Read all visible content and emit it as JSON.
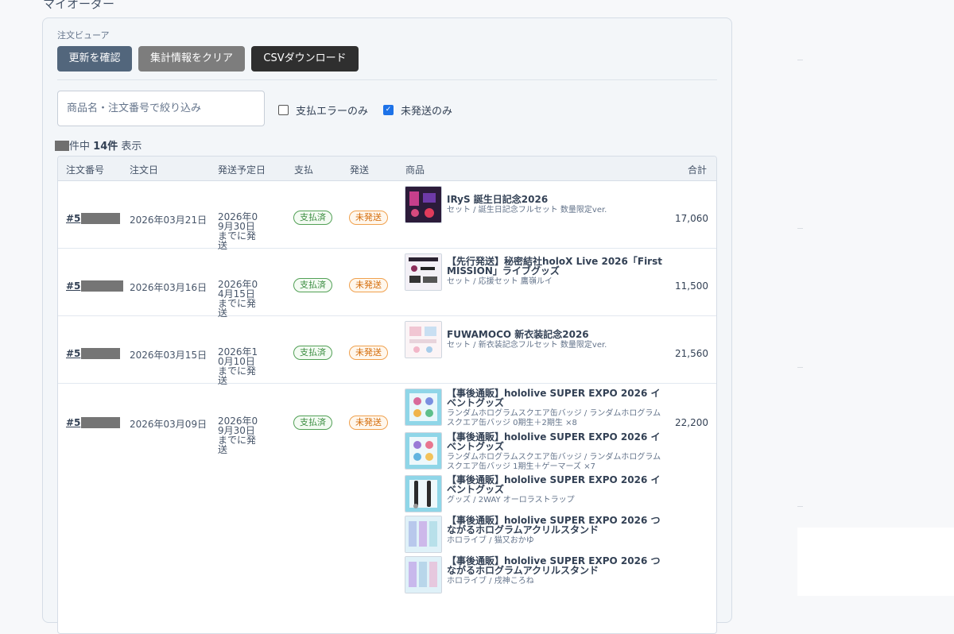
{
  "page": {
    "title": "マイオーダー"
  },
  "viewer": {
    "label": "注文ビューア",
    "buttons": {
      "check": "更新を確認",
      "clear": "集計情報をクリア",
      "csv": "CSVダウンロード"
    },
    "filter": {
      "placeholder": "商品名・注文番号で絞り込み",
      "value": ""
    },
    "checkboxes": {
      "payment_error": {
        "label": "支払エラーのみ",
        "checked": false
      },
      "unshipped": {
        "label": "未発送のみ",
        "checked": true
      }
    },
    "count": {
      "middle": "件中",
      "shown": "14件",
      "suffix": "表示"
    }
  },
  "table": {
    "headers": {
      "order_no": "注文番号",
      "order_date": "注文日",
      "ship_eta": "発送予定日",
      "payment": "支払",
      "shipping": "発送",
      "product": "商品",
      "total": "合計"
    },
    "rows": [
      {
        "order_no": "#5",
        "order_date": "2026年03月21日",
        "ship_eta": "2026年09月30日までに発送",
        "payment": "支払済",
        "shipping": "未発送",
        "total": "17,060",
        "products": [
          {
            "name": "IRyS 誕生日記念2026",
            "desc": "セット / 誕生日記念フルセット 数量限定ver."
          }
        ]
      },
      {
        "order_no": "#5",
        "order_date": "2026年03月16日",
        "ship_eta": "2026年04月15日までに発送",
        "payment": "支払済",
        "shipping": "未発送",
        "total": "11,500",
        "products": [
          {
            "name": "【先行発送】秘密結社holoX Live 2026「First MISSION」ライブグッズ",
            "desc": "セット / 応援セット 鷹嶺ルイ"
          }
        ]
      },
      {
        "order_no": "#5",
        "order_date": "2026年03月15日",
        "ship_eta": "2026年10月10日までに発送",
        "payment": "支払済",
        "shipping": "未発送",
        "total": "21,560",
        "products": [
          {
            "name": "FUWAMOCO 新衣装記念2026",
            "desc": "セット / 新衣装記念フルセット 数量限定ver."
          }
        ]
      },
      {
        "order_no": "#5",
        "order_date": "2026年03月09日",
        "ship_eta": "2026年09月30日までに発送",
        "payment": "支払済",
        "shipping": "未発送",
        "total": "22,200",
        "products": [
          {
            "name": "【事後通販】hololive SUPER EXPO 2026 イベントグッズ",
            "desc": "ランダムホログラムスクエア缶バッジ / ランダムホログラムスクエア缶バッジ 0期生＋2期生 ×8"
          },
          {
            "name": "【事後通販】hololive SUPER EXPO 2026 イベントグッズ",
            "desc": "ランダムホログラムスクエア缶バッジ / ランダムホログラムスクエア缶バッジ 1期生＋ゲーマーズ ×7"
          },
          {
            "name": "【事後通販】hololive SUPER EXPO 2026 イベントグッズ",
            "desc": "グッズ / 2WAY オーロラストラップ"
          },
          {
            "name": "【事後通販】hololive SUPER EXPO 2026 つながるホログラムアクリルスタンド",
            "desc": "ホロライブ / 猫又おかゆ"
          },
          {
            "name": "【事後通販】hololive SUPER EXPO 2026 つながるホログラムアクリルスタンド",
            "desc": "ホロライブ / 戌神ころね"
          }
        ]
      }
    ]
  }
}
